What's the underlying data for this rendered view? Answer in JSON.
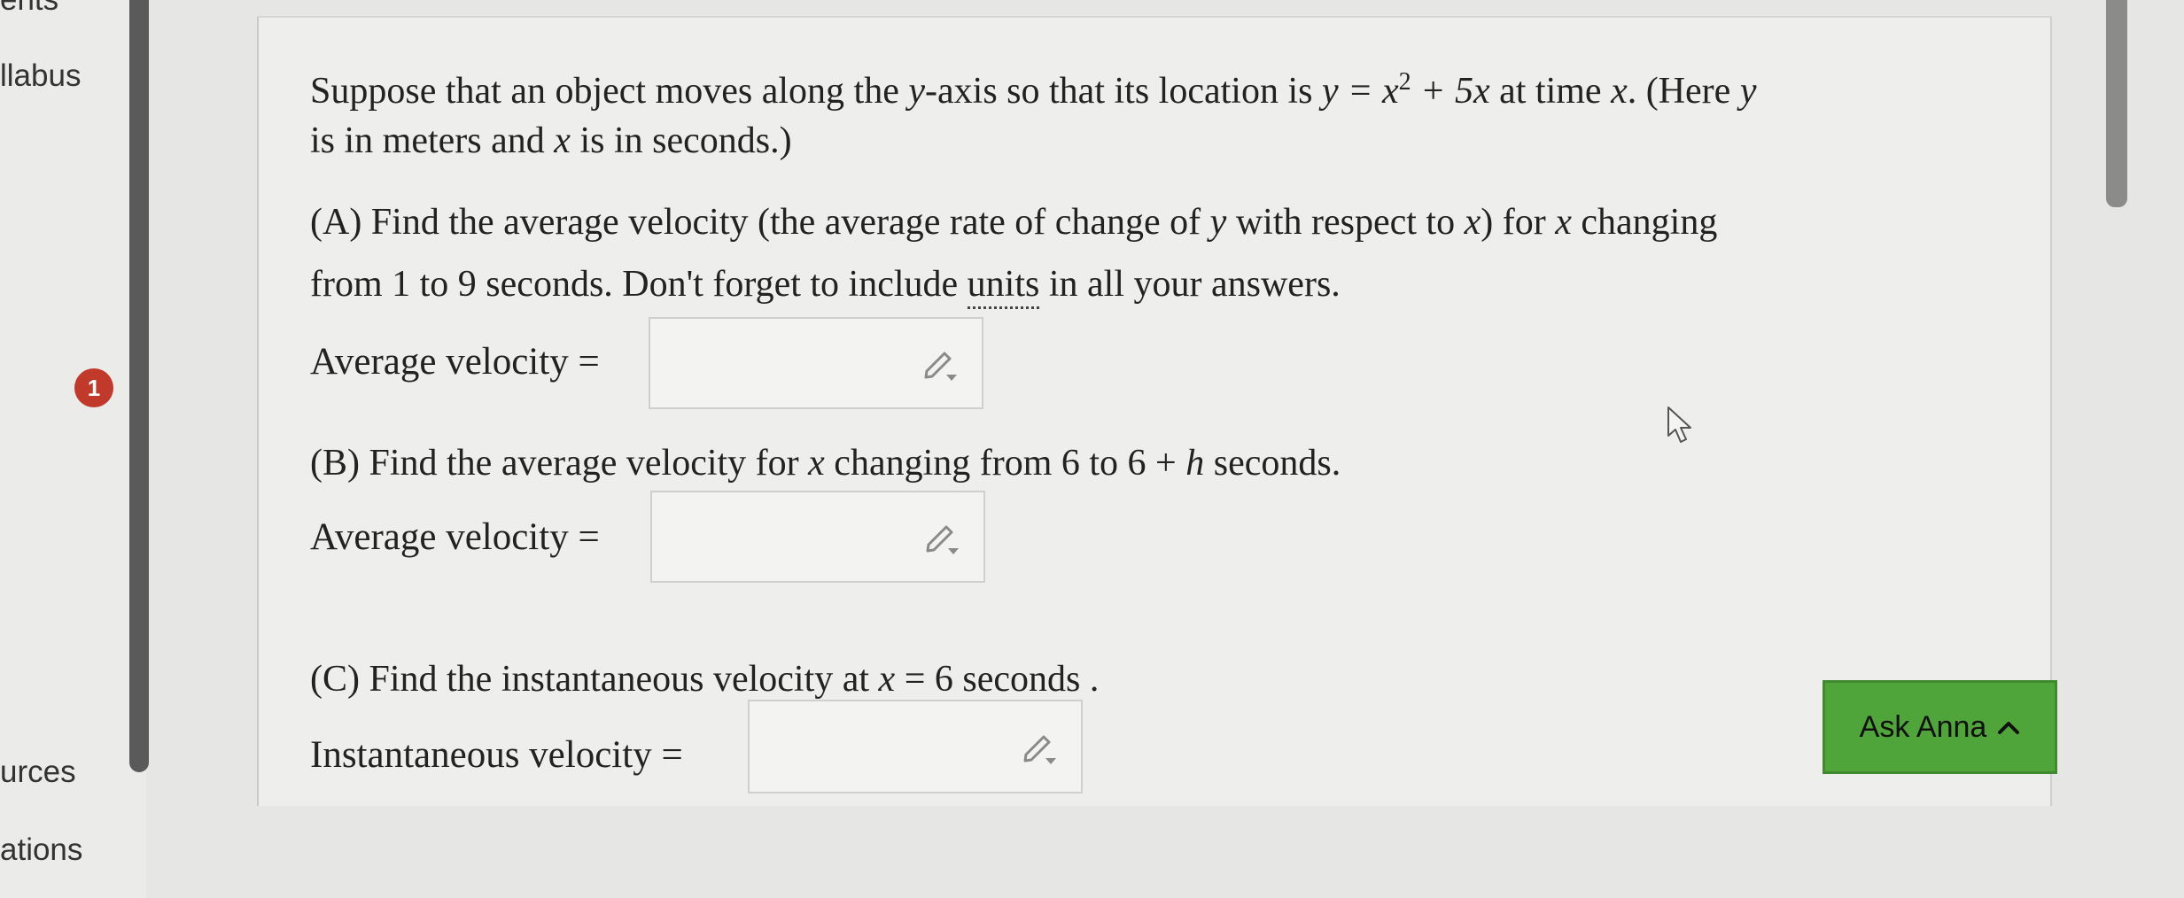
{
  "sidebar": {
    "items": [
      {
        "label": "ents"
      },
      {
        "label": "llabus"
      },
      {
        "label": "urces"
      },
      {
        "label": "ations"
      }
    ],
    "badge_count": "1"
  },
  "question": {
    "intro_line1": {
      "t1": "Suppose that an object moves along the ",
      "m1": "y",
      "t2": "-axis so that its location is ",
      "m2": "y = x",
      "sup": "2",
      "m3": " + 5x",
      "t3": " at time ",
      "m4": "x",
      "t4": ". (Here ",
      "m5": "y"
    },
    "intro_line2": {
      "t1": "is in meters and ",
      "m1": "x",
      "t2": " is in seconds.)"
    },
    "part_a": {
      "line1": {
        "t1": "(A) Find the average velocity (the average rate of change of ",
        "m1": "y",
        "t2": " with respect to ",
        "m2": "x",
        "t3": ") for ",
        "m3": "x",
        "t4": " changing"
      },
      "line2": {
        "t1": "from 1 to 9 seconds. Don't forget to include ",
        "link": "units",
        "t2": " in all your answers."
      },
      "answer_label": "Average velocity =",
      "answer_value": ""
    },
    "part_b": {
      "line1": {
        "t1": "(B) Find the average velocity for ",
        "m1": "x",
        "t2": " changing from 6 to 6 + ",
        "m2": "h",
        "t3": " seconds."
      },
      "answer_label": "Average velocity =",
      "answer_value": ""
    },
    "part_c": {
      "line1": {
        "t1": "(C) Find the instantaneous velocity at ",
        "m1": "x",
        "t2": " = 6 seconds ."
      },
      "answer_label": "Instantaneous velocity =",
      "answer_value": ""
    }
  },
  "ask_button": {
    "label": "Ask Anna"
  },
  "colors": {
    "ask_button": "#4fa43a",
    "badge": "#c0392b",
    "background": "#e6e6e4",
    "panel": "#eeeeec"
  },
  "icons": {
    "answer_tool": "pencil-icon",
    "ask_toggle": "chevron-up-icon",
    "pointer": "cursor-icon"
  }
}
